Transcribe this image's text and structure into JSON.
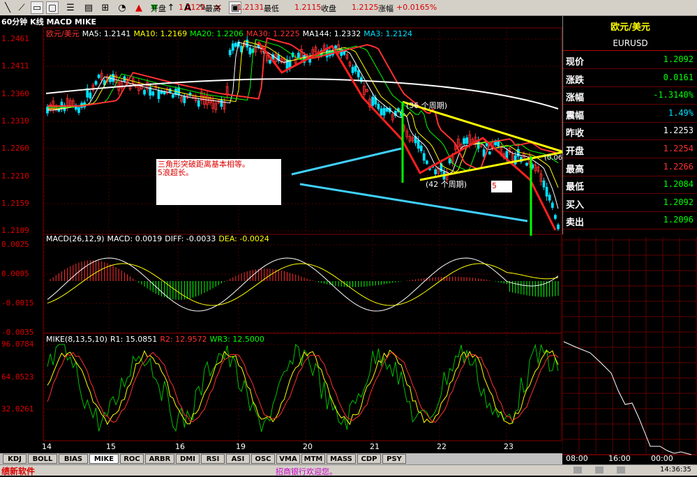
{
  "toolbar": {
    "title": "60分钟 K线 MACD MIKE",
    "open_label": "开盘",
    "open_value": "1.2122",
    "high_label": "最高",
    "high_value": "1.2131",
    "low_label": "最低",
    "low_value": "1.2115",
    "close_label": "收盘",
    "close_value": "1.2125",
    "change_label": "涨幅",
    "change_value": "+0.0165%"
  },
  "kline": {
    "legend": [
      {
        "text": "欧元/美元",
        "color": "#ff3030"
      },
      {
        "text": "MA5: 1.2141",
        "color": "#ffffff"
      },
      {
        "text": "MA10: 1.2169",
        "color": "#ffff00"
      },
      {
        "text": "MA20: 1.2206",
        "color": "#00ff00"
      },
      {
        "text": "MA30: 1.2225",
        "color": "#ff3030"
      },
      {
        "text": "MA144: 1.2332",
        "color": "#ffffff"
      },
      {
        "text": "MA3: 1.2124",
        "color": "#00e0ff"
      }
    ],
    "y_labels": [
      "1.2461",
      "1.2411",
      "1.2360",
      "1.2310",
      "1.2260",
      "1.2210",
      "1.2159",
      "1.2109"
    ],
    "note_lines": [
      "三角形突破距离基本相等。",
      "5浪超长。"
    ],
    "note5": "5",
    "label_top": "(36 个周期)",
    "label_bottom": "(42 个周期)",
    "label_right": "(0.06"
  },
  "macd": {
    "legend": [
      {
        "text": "MACD(26,12,9)",
        "color": "#ffffff"
      },
      {
        "text": "MACD: 0.0019",
        "color": "#ffffff"
      },
      {
        "text": "DIFF: -0.0033",
        "color": "#ffffff"
      },
      {
        "text": "DEA: -0.0024",
        "color": "#ffff00"
      }
    ],
    "y_labels": [
      "0.0025",
      "0.0005",
      "-0.0015",
      "-0.0035"
    ]
  },
  "mike": {
    "legend": [
      {
        "text": "MIKE(8,13,5,10)",
        "color": "#ffffff"
      },
      {
        "text": "R1: 15.0851",
        "color": "#ffffff"
      },
      {
        "text": "R2: 12.9572",
        "color": "#ff3030"
      },
      {
        "text": "WR3: 12.5000",
        "color": "#00ff00"
      }
    ],
    "y_labels": [
      "96.0784",
      "64.0523",
      "32.0261"
    ]
  },
  "x_labels": [
    "14",
    "15",
    "16",
    "19",
    "20",
    "21",
    "22",
    "23"
  ],
  "panel": {
    "title": "欧元/美元",
    "code": "EURUSD",
    "rows": [
      {
        "k": "现价",
        "v": "1.2092",
        "c": "#00ff00"
      },
      {
        "k": "涨跌",
        "v": "0.0161",
        "c": "#00ff00"
      },
      {
        "k": "涨幅",
        "v": "-1.3140%",
        "c": "#00ff00"
      },
      {
        "k": "震幅",
        "v": "1.49%",
        "c": "#00e0ff"
      },
      {
        "k": "昨收",
        "v": "1.2253",
        "c": "#ffffff"
      },
      {
        "k": "开盘",
        "v": "1.2254",
        "c": "#ff3030"
      },
      {
        "k": "最高",
        "v": "1.2266",
        "c": "#ff3030"
      },
      {
        "k": "最低",
        "v": "1.2084",
        "c": "#00ff00"
      },
      {
        "k": "买入",
        "v": "1.2092",
        "c": "#00ff00"
      },
      {
        "k": "卖出",
        "v": "1.2096",
        "c": "#00ff00"
      }
    ],
    "mini_x": [
      "08:00",
      "16:00",
      "00:00"
    ]
  },
  "tabs": [
    "KDJ",
    "BOLL",
    "BIAS",
    "MIKE",
    "ROC",
    "ARBR",
    "DMI",
    "RSI",
    "ASI",
    "OSC",
    "VMA",
    "MTM",
    "MASS",
    "CDP",
    "PSY"
  ],
  "active_tab": "MIKE",
  "status": {
    "logo": "绩新软件",
    "message": "招商银行欢迎您。",
    "time": "14:36:35"
  },
  "colors": {
    "up": "#ff3030",
    "down": "#00e0ff",
    "grid": "#800000"
  }
}
